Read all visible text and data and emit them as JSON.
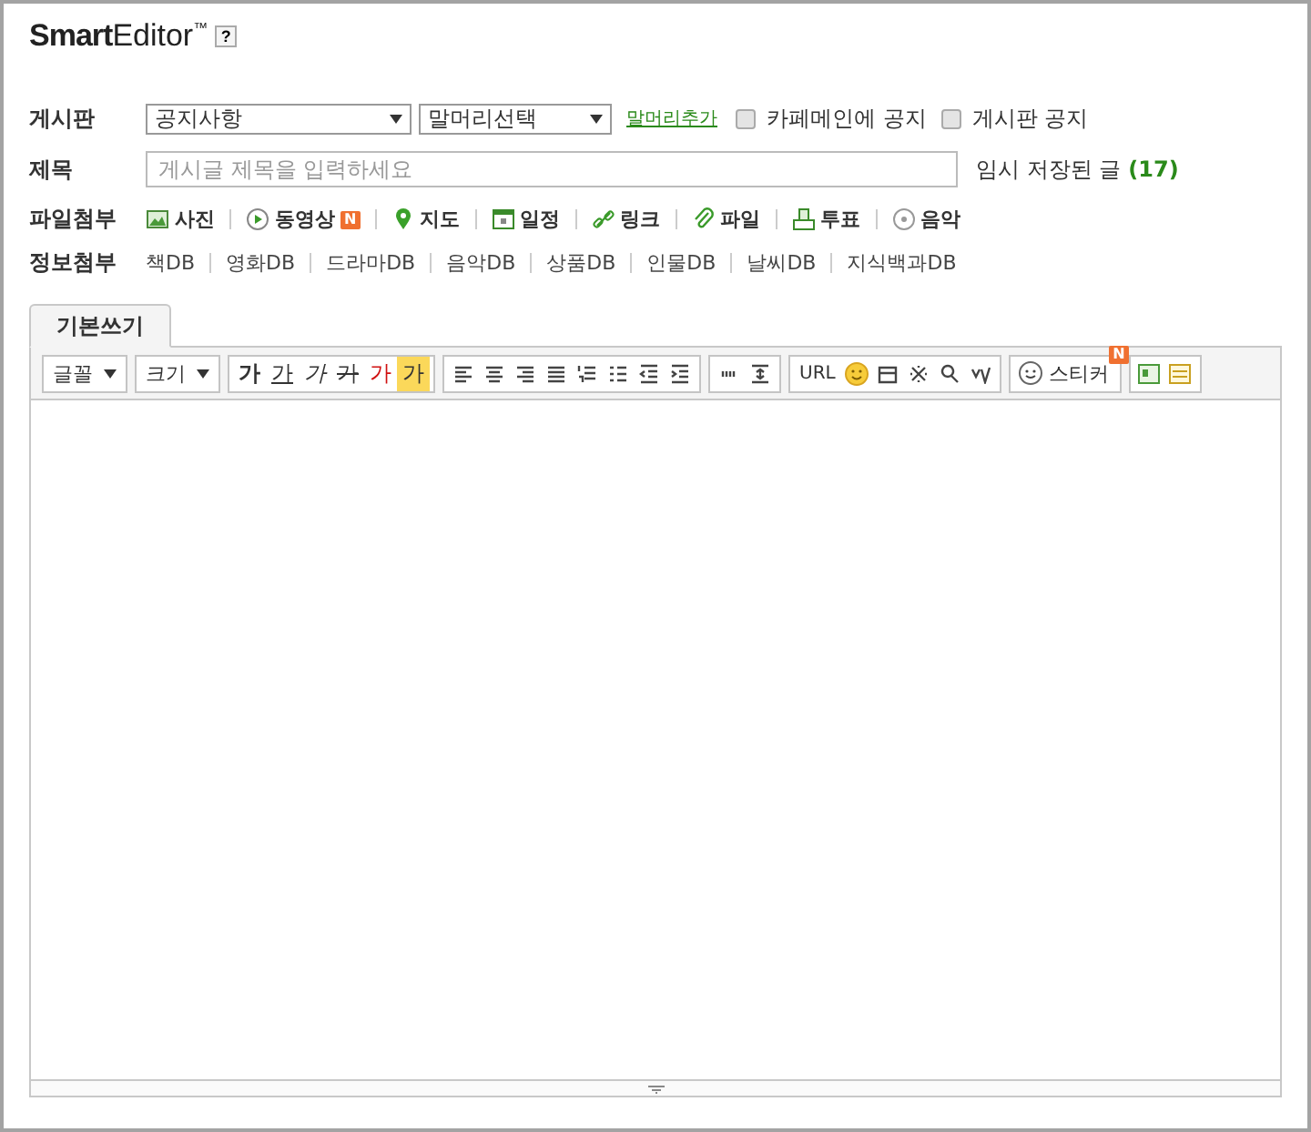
{
  "header": {
    "title_bold": "Smart",
    "title_light": "Editor",
    "trademark": "™",
    "help": "?"
  },
  "board_row": {
    "label": "게시판",
    "selects": [
      "공지사항",
      "말머리선택"
    ],
    "link": "말머리추가",
    "checkboxes": [
      {
        "label": "카페메인에 공지",
        "checked": false
      },
      {
        "label": "게시판 공지",
        "checked": false
      }
    ]
  },
  "title_row": {
    "label": "제목",
    "placeholder": "게시글 제목을 입력하세요",
    "saved_label": "임시 저장된 글",
    "saved_count": "(17)"
  },
  "file_attach": {
    "label": "파일첨부",
    "items": [
      {
        "kind": "photo",
        "label": "사진"
      },
      {
        "kind": "video",
        "label": "동영상",
        "badge": "N"
      },
      {
        "kind": "map",
        "label": "지도"
      },
      {
        "kind": "calendar",
        "label": "일정"
      },
      {
        "kind": "link",
        "label": "링크"
      },
      {
        "kind": "file",
        "label": "파일"
      },
      {
        "kind": "vote",
        "label": "투표"
      },
      {
        "kind": "music",
        "label": "음악"
      }
    ]
  },
  "info_attach": {
    "label": "정보첨부",
    "items": [
      "책DB",
      "영화DB",
      "드라마DB",
      "음악DB",
      "상품DB",
      "인물DB",
      "날씨DB",
      "지식백과DB"
    ]
  },
  "tabs": [
    {
      "label": "기본쓰기",
      "selected": true
    }
  ],
  "toolbar": {
    "dropdowns": [
      "글꼴",
      "크기"
    ],
    "format_buttons": [
      {
        "kind": "bold",
        "label": "가"
      },
      {
        "kind": "underline",
        "label": "가"
      },
      {
        "kind": "italic",
        "label": "가"
      },
      {
        "kind": "strike",
        "label": "가"
      },
      {
        "kind": "color",
        "label": "가"
      },
      {
        "kind": "highlight",
        "label": "가"
      }
    ],
    "url": "URL",
    "sticker": "스티커",
    "sticker_badge": "N"
  }
}
